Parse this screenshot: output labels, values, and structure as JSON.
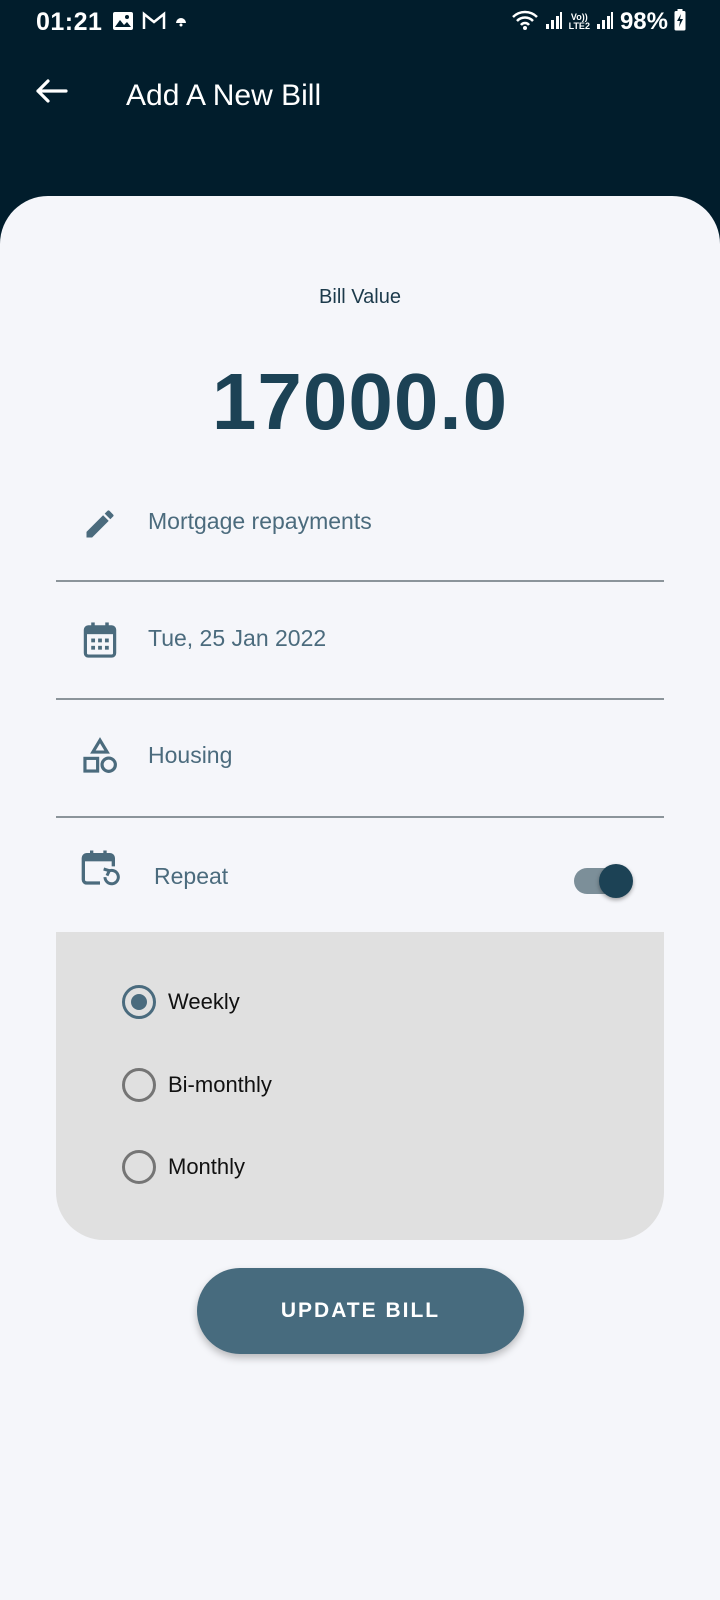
{
  "status_bar": {
    "time": "01:21",
    "battery": "98%",
    "network_label_top": "Vo))",
    "network_label_bottom": "LTE2",
    "left_icons": [
      "image-icon",
      "gmail-icon",
      "notification-icon"
    ],
    "right_icons": [
      "wifi-icon",
      "signal-icon",
      "signal-icon",
      "battery-charging-icon"
    ]
  },
  "app_bar": {
    "title": "Add A New Bill",
    "back_icon": "arrow-back-icon"
  },
  "bill": {
    "label": "Bill Value",
    "value": "17000.0"
  },
  "fields": [
    {
      "icon": "pencil-icon",
      "text": "Mortgage repayments"
    },
    {
      "icon": "calendar-icon",
      "text": "Tue, 25 Jan 2022"
    },
    {
      "icon": "category-shapes-icon",
      "text": "Housing"
    }
  ],
  "repeat": {
    "icon": "calendar-repeat-icon",
    "label": "Repeat",
    "enabled": true,
    "options": [
      {
        "label": "Weekly",
        "selected": true
      },
      {
        "label": "Bi-monthly",
        "selected": false
      },
      {
        "label": "Monthly",
        "selected": false
      }
    ]
  },
  "actions": {
    "update_label": "UPDATE BILL"
  },
  "colors": {
    "app_bar_bg": "#011d2c",
    "sheet_bg": "#f5f6fa",
    "accent": "#1c4255",
    "button_bg": "#476b7e",
    "field_text": "#4b6b7d",
    "panel_bg": "#e0e0e0"
  }
}
